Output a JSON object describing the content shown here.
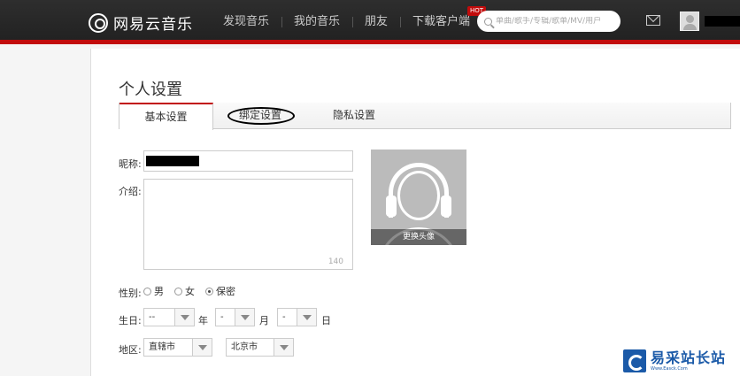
{
  "header": {
    "logo_text": "网易云音乐",
    "nav": [
      "发现音乐",
      "我的音乐",
      "朋友",
      "下载客户端"
    ],
    "hot_badge": "HOT",
    "search_placeholder": "单曲/歌手/专辑/歌单/MV/用户",
    "accent_color": "#c20c0c"
  },
  "page": {
    "title": "个人设置",
    "tabs": [
      "基本设置",
      "绑定设置",
      "隐私设置"
    ],
    "active_tab": "基本设置"
  },
  "form": {
    "nickname_label": "昵称:",
    "intro_label": "介绍:",
    "intro_counter": "140",
    "gender_label": "性别:",
    "gender_options": [
      "男",
      "女",
      "保密"
    ],
    "gender_selected": "保密",
    "birthday_label": "生日:",
    "birthday_year": "--",
    "birthday_month": "-",
    "birthday_day": "-",
    "year_unit": "年",
    "month_unit": "月",
    "day_unit": "日",
    "region_label": "地区:",
    "province": "直辖市",
    "city": "北京市"
  },
  "avatar": {
    "change_label": "更换头像"
  },
  "watermark": {
    "title": "易采站长站",
    "subtitle": "Www.Easck.Com"
  }
}
